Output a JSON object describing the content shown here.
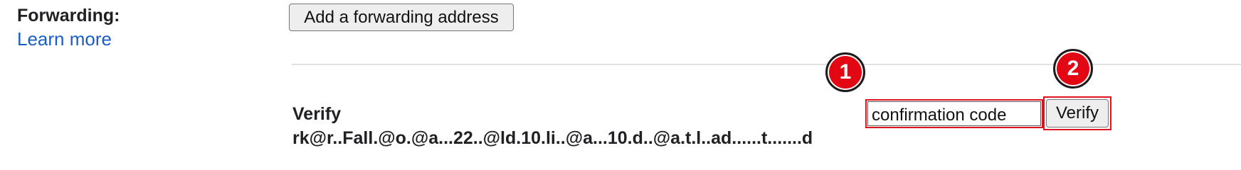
{
  "forwarding": {
    "label": "Forwarding:",
    "learn_more": "Learn more",
    "add_button": "Add a forwarding address"
  },
  "verify": {
    "heading": "Verify",
    "code_input_value": "confirmation code",
    "verify_button": "Verify",
    "truncated_line": "rk@r..Fall.@o.@a...22..@ld.10.li..@a...10.d..@a.t.l..ad......t.......d"
  },
  "markers": {
    "one": "1",
    "two": "2"
  },
  "colors": {
    "link": "#1a5dc7",
    "highlight": "#e0141e",
    "marker": "#e30613"
  }
}
